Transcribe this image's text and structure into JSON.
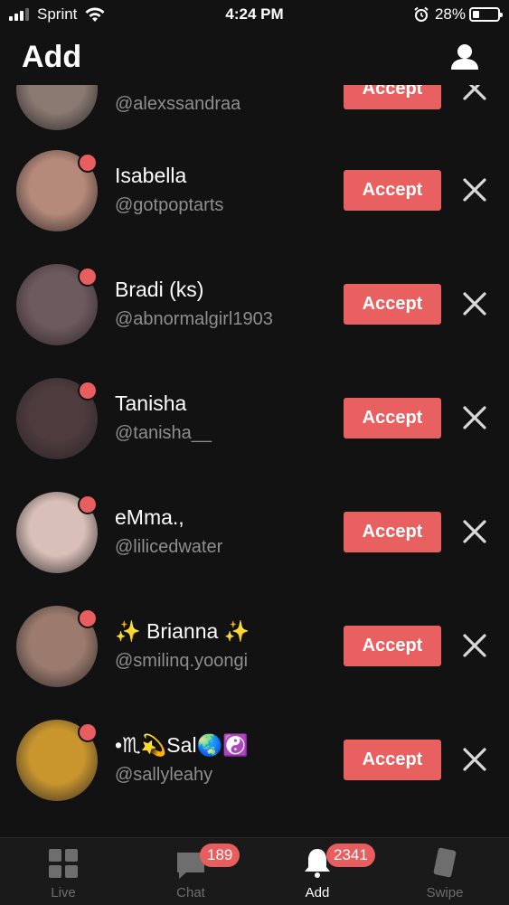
{
  "status_bar": {
    "carrier": "Sprint",
    "time": "4:24 PM",
    "battery_percent": "28%",
    "battery_level": 0.28
  },
  "header": {
    "title": "Add",
    "profile_icon": "person-icon"
  },
  "requests": [
    {
      "name": "",
      "username": "@alexssandraa",
      "accept_label": "Accept",
      "avatar_color": "#8a7a72"
    },
    {
      "name": "Isabella",
      "username": "@gotpoptarts",
      "accept_label": "Accept",
      "avatar_color": "#b58a7a"
    },
    {
      "name": "Bradi (ks)",
      "username": "@abnormalgirl1903",
      "accept_label": "Accept",
      "avatar_color": "#6d5a5e"
    },
    {
      "name": "Tanisha",
      "username": "@tanisha__",
      "accept_label": "Accept",
      "avatar_color": "#4d3b3d"
    },
    {
      "name": "eMma.,",
      "username": "@lilicedwater",
      "accept_label": "Accept",
      "avatar_color": "#d8c0b8"
    },
    {
      "name": "✨ Brianna ✨",
      "username": "@smilinq.yoongi",
      "accept_label": "Accept",
      "avatar_color": "#9c7b6e"
    },
    {
      "name": "•♏💫Sal🌏☯️",
      "username": "@sallyleahy",
      "accept_label": "Accept",
      "avatar_color": "#c9962e"
    }
  ],
  "tabbar": {
    "tabs": [
      {
        "label": "Live",
        "icon": "grid-icon"
      },
      {
        "label": "Chat",
        "icon": "chat-bubble-icon",
        "badge": "189"
      },
      {
        "label": "Add",
        "icon": "bell-icon",
        "badge": "2341"
      },
      {
        "label": "Swipe",
        "icon": "card-icon"
      }
    ],
    "active": "Add"
  },
  "colors": {
    "background": "#121212",
    "accent": "#e86060",
    "muted_text": "#8e8e8e"
  }
}
